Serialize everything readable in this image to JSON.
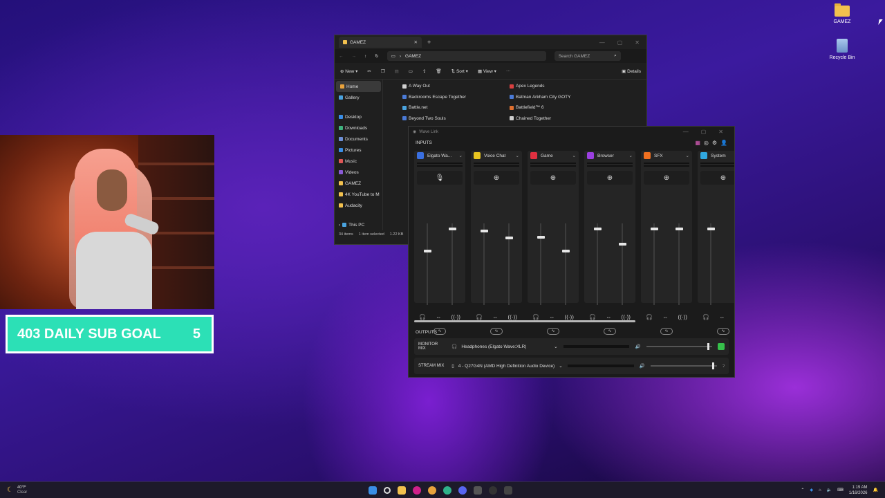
{
  "desktop": {
    "icons": [
      {
        "label": "GAMEZ",
        "icon": "folder-icon"
      },
      {
        "label": "Recycle Bin",
        "icon": "recycle-bin-icon"
      }
    ]
  },
  "overlay": {
    "goal_label": "403 DAILY SUB GOAL",
    "goal_count": "5",
    "goal_color": "#2ce0b6"
  },
  "explorer": {
    "tab_title": "GAMEZ",
    "address": "GAMEZ",
    "search_placeholder": "Search GAMEZ",
    "toolbar": {
      "new": "New",
      "sort": "Sort",
      "view": "View",
      "more": "···",
      "details": "Details"
    },
    "sidebar": [
      {
        "label": "Home",
        "icon": "home-icon",
        "color": "#e8a23c"
      },
      {
        "label": "Gallery",
        "icon": "gallery-icon",
        "color": "#4aa3df"
      },
      {
        "label": "Desktop",
        "icon": "desktop-icon",
        "color": "#3a8ee6"
      },
      {
        "label": "Downloads",
        "icon": "downloads-icon",
        "color": "#3fb37f"
      },
      {
        "label": "Documents",
        "icon": "documents-icon",
        "color": "#6d8fd6"
      },
      {
        "label": "Pictures",
        "icon": "pictures-icon",
        "color": "#3a8ee6"
      },
      {
        "label": "Music",
        "icon": "music-icon",
        "color": "#e05757"
      },
      {
        "label": "Videos",
        "icon": "videos-icon",
        "color": "#8a5ad6"
      },
      {
        "label": "GAMEZ",
        "icon": "folder-icon",
        "color": "#f2c14e"
      },
      {
        "label": "4K YouTube to M",
        "icon": "folder-icon",
        "color": "#f2c14e"
      },
      {
        "label": "Audacity",
        "icon": "folder-icon",
        "color": "#f2c14e"
      },
      {
        "label": "This PC",
        "icon": "this-pc-icon",
        "color": "#4aa3df"
      }
    ],
    "files": [
      {
        "name": "A Way Out",
        "color": "#d0d0d0"
      },
      {
        "name": "Apex Legends",
        "color": "#d84040"
      },
      {
        "name": "Backrooms Escape Together",
        "color": "#4a7ad6"
      },
      {
        "name": "Batman Arkham City GOTY",
        "color": "#4a7ad6"
      },
      {
        "name": "Battle.net",
        "color": "#4aa3df"
      },
      {
        "name": "Battlefield™ 6",
        "color": "#e07030"
      },
      {
        "name": "Beyond Two Souls",
        "color": "#4a7ad6"
      },
      {
        "name": "Chained Together",
        "color": "#d0d0d0"
      }
    ],
    "status": {
      "count": "34 items",
      "selected": "1 item selected",
      "size": "1.22 KB"
    }
  },
  "wavelink": {
    "title": "Wave Link",
    "inputs_label": "INPUTS",
    "outputs_label": "OUTPUTS",
    "channels": [
      {
        "name": "Elgato Wa...",
        "color": "#3a6fe0",
        "add_icon": "microphone-icon",
        "fader_a": 0.68,
        "fader_b": 0.95
      },
      {
        "name": "Voice Chat",
        "color": "#e8c420",
        "add_icon": "plus-icon",
        "fader_a": 0.92,
        "fader_b": 0.84
      },
      {
        "name": "Game",
        "color": "#e03040",
        "add_icon": "plus-icon",
        "fader_a": 0.85,
        "fader_b": 0.68
      },
      {
        "name": "Browser",
        "color": "#9b3fe0",
        "add_icon": "plus-icon",
        "fader_a": 0.95,
        "fader_b": 0.76
      },
      {
        "name": "SFX",
        "color": "#f07020",
        "add_icon": "plus-icon",
        "fader_a": 0.95,
        "fader_b": 0.95
      },
      {
        "name": "System",
        "color": "#30a8e0",
        "add_icon": "plus-icon",
        "fader_a": 0.95,
        "fader_b": null
      }
    ],
    "outputs": [
      {
        "name": "MONITOR MIX",
        "device": "Headphones (Elgato Wave:XLR)",
        "device_icon": "headphones-icon",
        "level": 0.95,
        "state_color": "#36c04a"
      },
      {
        "name": "STREAM MIX",
        "device": "4 - Q27G4N (AMD High Definition Audio Device)",
        "device_icon": "speaker-icon",
        "level": 0.95,
        "state_color": null
      }
    ]
  },
  "taskbar": {
    "temp": "40°F",
    "condition": "Clear",
    "time": "1:19 AM",
    "date": "1/16/2026"
  }
}
